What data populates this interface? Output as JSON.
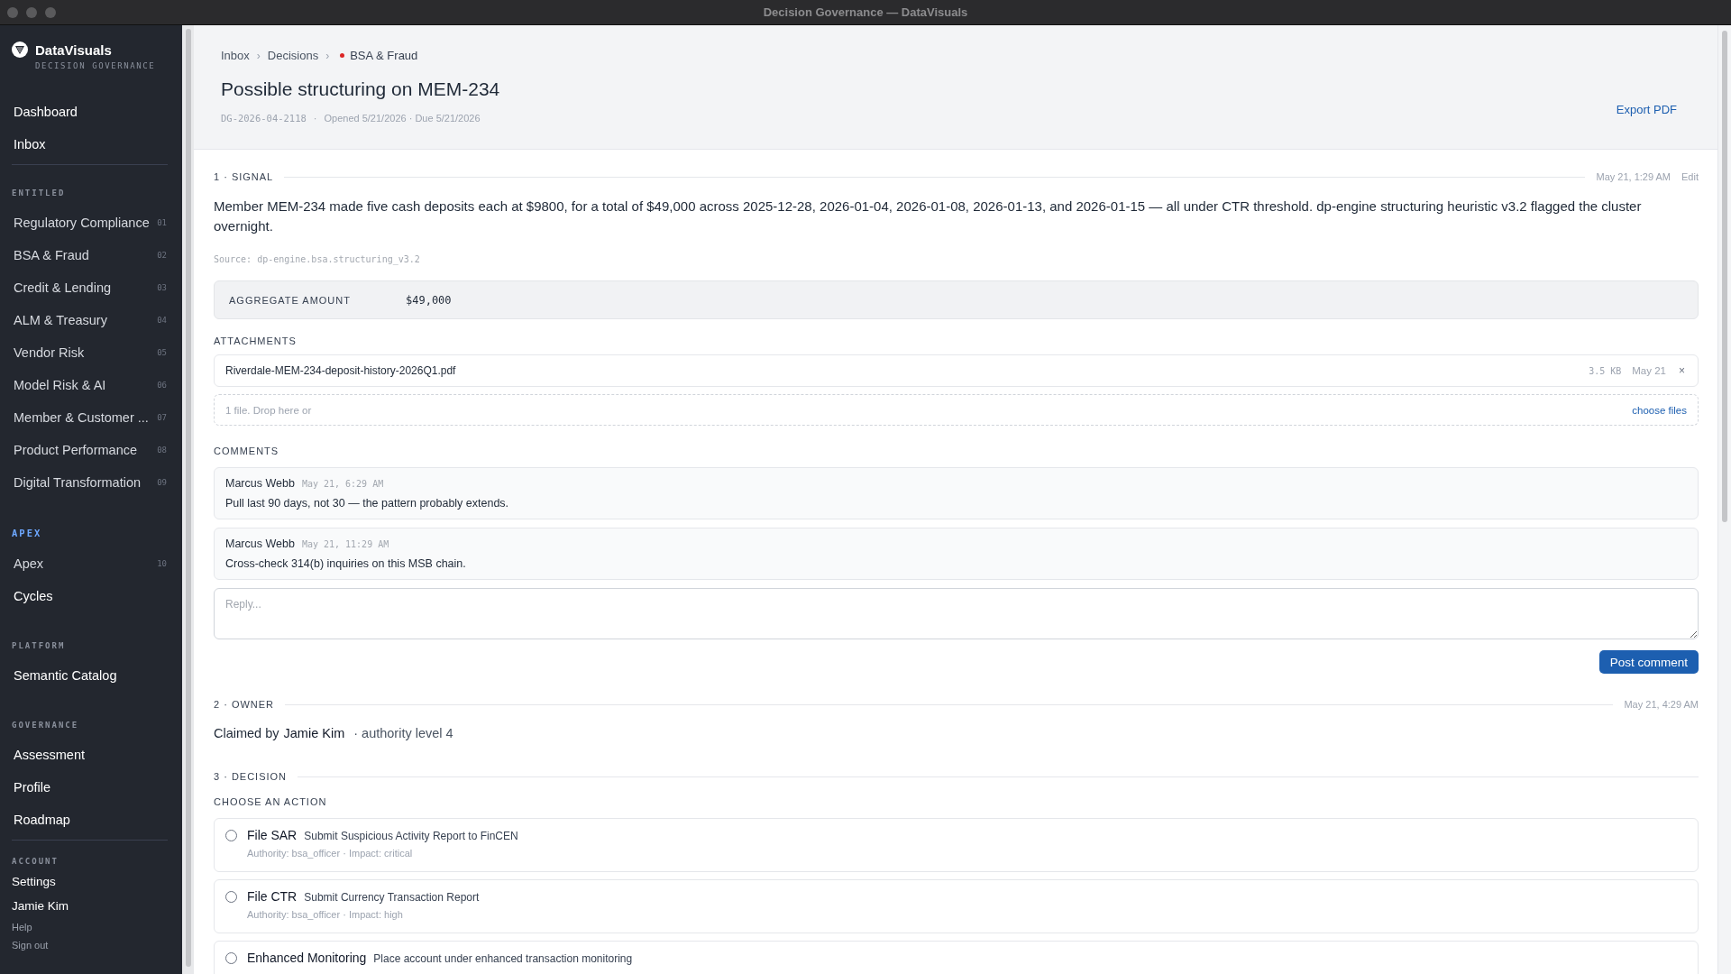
{
  "window": {
    "title": "Decision Governance — DataVisuals"
  },
  "sidebar": {
    "brand": "DataVisuals",
    "tagline": "DECISION GOVERNANCE",
    "top_items": [
      "Dashboard",
      "Inbox"
    ],
    "sections": [
      {
        "heading": "ENTITLED",
        "highlighted": false,
        "items": [
          {
            "label": "Regulatory Compliance",
            "count": "01"
          },
          {
            "label": "BSA & Fraud",
            "count": "02"
          },
          {
            "label": "Credit & Lending",
            "count": "03"
          },
          {
            "label": "ALM & Treasury",
            "count": "04"
          },
          {
            "label": "Vendor Risk",
            "count": "05"
          },
          {
            "label": "Model Risk & AI",
            "count": "06"
          },
          {
            "label": "Member & Customer ...",
            "count": "07"
          },
          {
            "label": "Product Performance",
            "count": "08"
          },
          {
            "label": "Digital Transformation",
            "count": "09"
          }
        ]
      },
      {
        "heading": "APEX",
        "highlighted": true,
        "items": [
          {
            "label": "Apex",
            "count": "10"
          },
          {
            "label": "Cycles"
          }
        ]
      },
      {
        "heading": "PLATFORM",
        "highlighted": false,
        "items": [
          {
            "label": "Semantic Catalog"
          }
        ]
      },
      {
        "heading": "GOVERNANCE",
        "highlighted": false,
        "items": [
          {
            "label": "Assessment"
          },
          {
            "label": "Profile"
          },
          {
            "label": "Roadmap"
          }
        ]
      }
    ],
    "account": {
      "heading": "ACCOUNT",
      "settings": "Settings",
      "user": "Jamie Kim",
      "help": "Help",
      "sign_out": "Sign out"
    }
  },
  "header": {
    "breadcrumb": [
      "Inbox",
      "Decisions"
    ],
    "breadcrumb_separator": "›",
    "current": {
      "label": "BSA & Fraud",
      "color": "#dc2626"
    },
    "title": "Possible structuring on MEM-234",
    "id": "DG-2026-04-2118",
    "meta_separator": "·",
    "dates": "Opened 5/21/2026 · Due 5/21/2026",
    "export": "Export PDF"
  },
  "signal": {
    "heading": "1 · SIGNAL",
    "time": "May 21, 1:29 AM",
    "edit": "Edit",
    "body": "Member MEM-234 made five cash deposits each at $9800, for a total of $49,000 across 2025-12-28, 2026-01-04, 2026-01-08, 2026-01-13, and 2026-01-15 — all under CTR threshold. dp-engine structuring heuristic v3.2 flagged the cluster overnight.",
    "source": "Source: dp-engine.bsa.structuring_v3.2",
    "metric_label": "AGGREGATE AMOUNT",
    "metric_value": "$49,000",
    "attachments_label": "ATTACHMENTS",
    "attachments": [
      {
        "name": "Riverdale-MEM-234-deposit-history-2026Q1.pdf",
        "size": "3.5 KB",
        "date": "May 21",
        "remove": "×"
      }
    ],
    "drop_text": "1 file. Drop here or",
    "choose": "choose files",
    "comments_label": "COMMENTS",
    "comments": [
      {
        "author": "Marcus Webb",
        "time": "May 21, 6:29 AM",
        "text": "Pull last 90 days, not 30 — the pattern probably extends."
      },
      {
        "author": "Marcus Webb",
        "time": "May 21, 11:29 AM",
        "text": "Cross-check 314(b) inquiries on this MSB chain."
      }
    ],
    "reply_placeholder": "Reply...",
    "post": "Post comment"
  },
  "owner": {
    "heading": "2 · OWNER",
    "time": "May 21, 4:29 AM",
    "claimed_prefix": "Claimed by",
    "name": "Jamie Kim",
    "authority": "· authority level 4"
  },
  "decision": {
    "heading": "3 · DECISION",
    "choose_label": "CHOOSE AN ACTION",
    "options": [
      {
        "title": "File SAR",
        "desc": "Submit Suspicious Activity Report to FinCEN",
        "meta": "Authority: bsa_officer · Impact: critical",
        "selected": false
      },
      {
        "title": "File CTR",
        "desc": "Submit Currency Transaction Report",
        "meta": "Authority: bsa_officer · Impact: high",
        "selected": false
      },
      {
        "title": "Enhanced Monitoring",
        "desc": "Place account under enhanced transaction monitoring",
        "selected": false
      }
    ]
  }
}
